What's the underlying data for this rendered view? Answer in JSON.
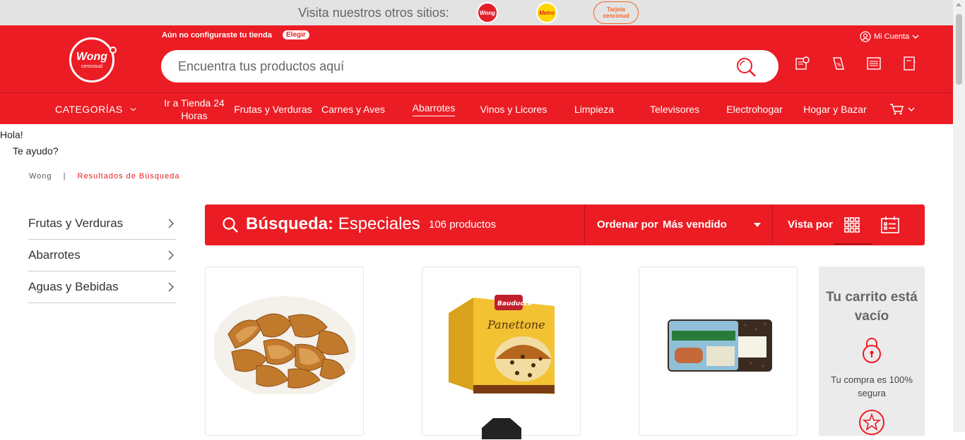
{
  "topbar": {
    "visit_text": "Visita nuestros otros sitios:",
    "sites": [
      "Wong",
      "Metro",
      "Tarjeta cencosud"
    ]
  },
  "header": {
    "logo_text": "Wong",
    "logo_sub": "cencosud",
    "store_message": "Aún no configuraste tu tienda",
    "elegir_label": "Elegir",
    "search_placeholder": "Encuentra tus productos aquí",
    "account_label": "Mi Cuenta",
    "icons": [
      "receipt-search-icon",
      "coupon-icon",
      "list-icon",
      "notebook-icon"
    ]
  },
  "nav": {
    "categorias": "CATEGORÍAS",
    "items": [
      "Ir a Tienda 24 Horas",
      "Frutas y Verduras",
      "Carnes y Aves",
      "Abarrotes",
      "Vinos y Licores",
      "Limpieza",
      "Televisores",
      "Electrohogar",
      "Hogar y Bazar"
    ],
    "active": "Abarrotes"
  },
  "chat": {
    "hello": "Hola!",
    "help": "Te ayudo?"
  },
  "breadcrumb": {
    "home": "Wong",
    "separator": "|",
    "current": "Resultados de Búsqueda"
  },
  "sidebar": {
    "categories": [
      "Frutas y Verduras",
      "Abarrotes",
      "Aguas y Bebidas"
    ]
  },
  "results": {
    "search_prefix": "Búsqueda:",
    "search_term": "Especiales",
    "count": "106 productos",
    "order_label": "Ordenar por",
    "order_value": "Más vendido",
    "view_label": "Vista por"
  },
  "products": [
    {
      "image": "potato-wedges"
    },
    {
      "image": "panettone-box",
      "brand_text": "Bauducco",
      "name_text": "Panettone"
    },
    {
      "image": "rye-bread-pack"
    }
  ],
  "cart": {
    "title": "Tu carrito está vacío",
    "secure_text": "Tu compra es 100% segura"
  },
  "colors": {
    "brand_red": "#ec1c24",
    "topbar_gray": "#e3e3e3"
  }
}
